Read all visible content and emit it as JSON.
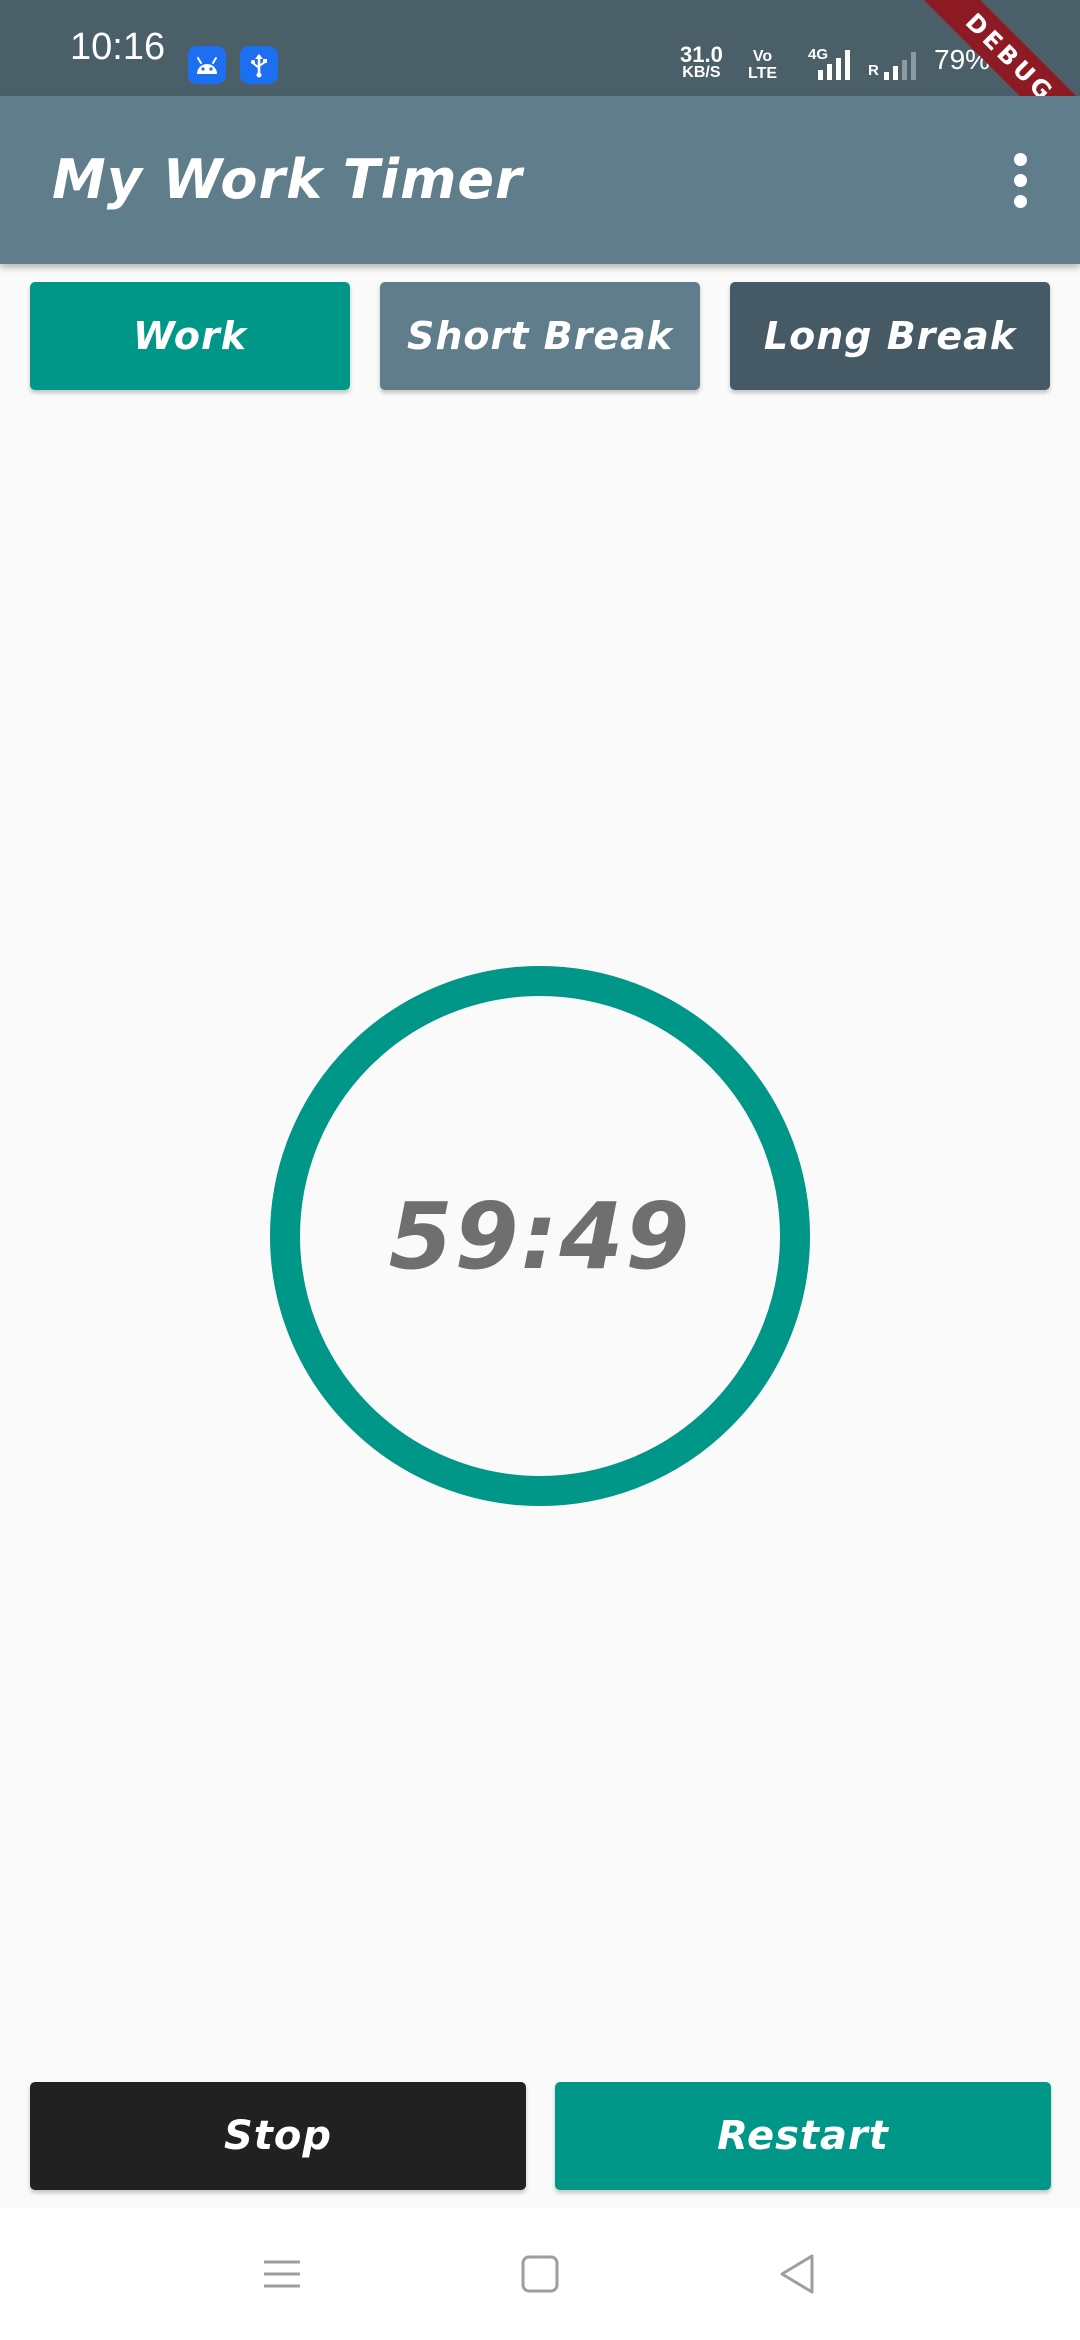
{
  "status_bar": {
    "time": "10:16",
    "speed_value": "31.0",
    "speed_unit": "KB/S",
    "volte_top": "Vo",
    "volte_bottom": "LTE",
    "network_type": "4G",
    "roaming_label": "R",
    "battery": "79%",
    "debug_label": "DEBUG",
    "notification_icons": [
      "android-icon",
      "usb-icon"
    ]
  },
  "app_bar": {
    "title": "My Work Timer",
    "menu_icon": "more-vert-icon"
  },
  "modes": {
    "work": "Work",
    "short_break": "Short Break",
    "long_break": "Long Break"
  },
  "timer": {
    "display": "59:49",
    "progress": 1.0
  },
  "actions": {
    "stop": "Stop",
    "restart": "Restart"
  },
  "nav_bar": {
    "icons": [
      "menu-icon",
      "home-icon",
      "back-icon"
    ]
  },
  "colors": {
    "primary": "#009688",
    "app_bar": "#607D8B",
    "status_bar": "#4B5F69",
    "long_break": "#455A64",
    "stop": "#212121",
    "timer_text": "#6F6F6F",
    "background": "#FAFAFA"
  }
}
